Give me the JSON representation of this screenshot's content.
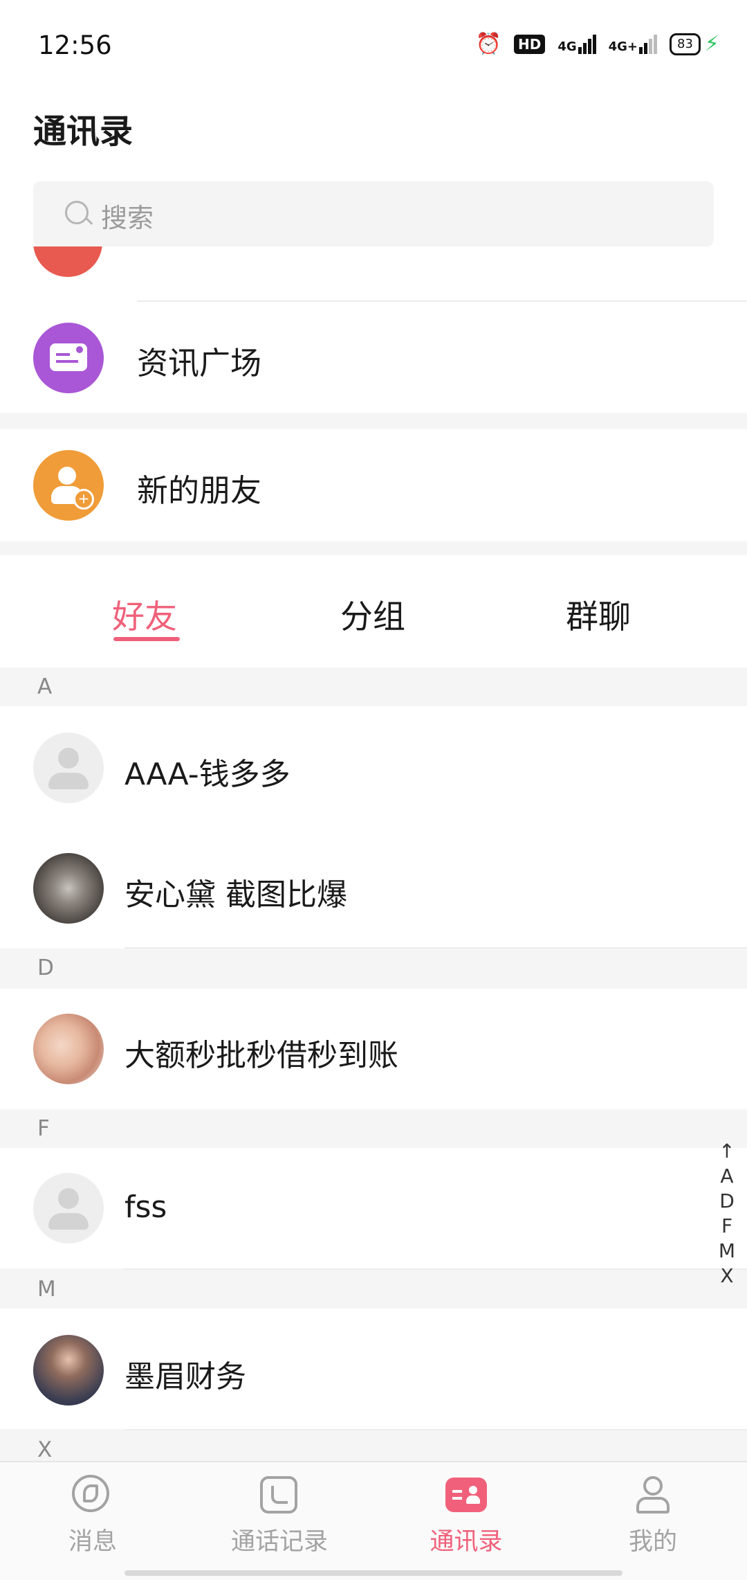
{
  "status_bar": {
    "time": "12:56",
    "hd": "HD",
    "net1": "4G",
    "net2": "4G+",
    "battery": "83"
  },
  "header": {
    "title": "通讯录"
  },
  "search": {
    "placeholder": "搜索"
  },
  "special_rows": [
    {
      "label": "资讯广场",
      "icon": "news-icon",
      "color": "#a957d6"
    },
    {
      "label": "新的朋友",
      "icon": "add-friend-icon",
      "color": "#f09c38"
    }
  ],
  "tabs": [
    {
      "label": "好友",
      "active": true
    },
    {
      "label": "分组",
      "active": false
    },
    {
      "label": "群聊",
      "active": false
    }
  ],
  "sections": [
    {
      "letter": "A",
      "contacts": [
        "AAA-钱多多",
        "安心黛 截图比爆"
      ]
    },
    {
      "letter": "D",
      "contacts": [
        "大额秒批秒借秒到账"
      ]
    },
    {
      "letter": "F",
      "contacts": [
        "fss"
      ]
    },
    {
      "letter": "M",
      "contacts": [
        "墨眉财务"
      ]
    },
    {
      "letter": "X",
      "contacts": []
    }
  ],
  "index_bar": [
    "↑",
    "A",
    "D",
    "F",
    "M",
    "X"
  ],
  "bottom_nav": [
    {
      "label": "消息",
      "icon": "message-icon",
      "active": false
    },
    {
      "label": "通话记录",
      "icon": "call-log-icon",
      "active": false
    },
    {
      "label": "通讯录",
      "icon": "contacts-icon",
      "active": true
    },
    {
      "label": "我的",
      "icon": "profile-icon",
      "active": false
    }
  ],
  "colors": {
    "accent": "#f0607a",
    "background": "#f5f5f5"
  }
}
